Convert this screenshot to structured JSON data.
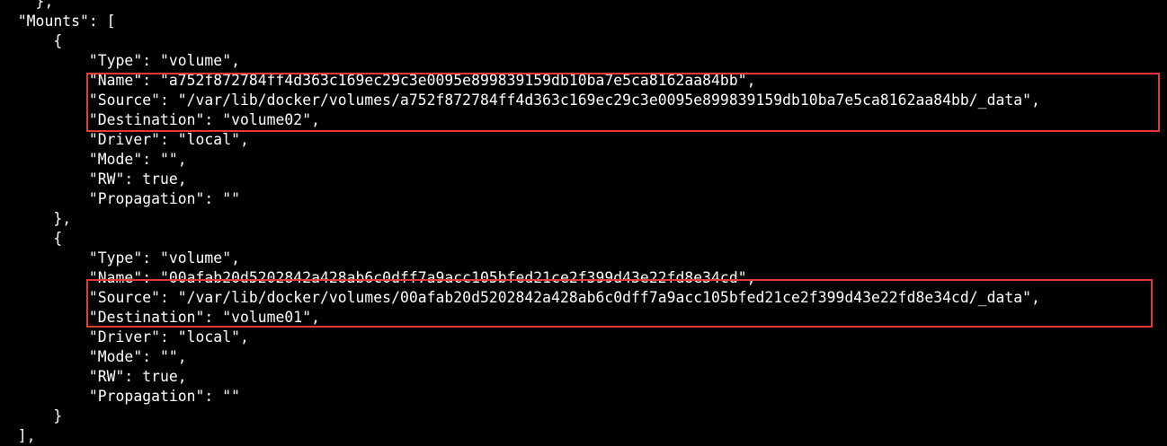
{
  "terminal": {
    "lines": [
      "    },",
      "  \"Mounts\": [",
      "      {",
      "          \"Type\": \"volume\",",
      "          \"Name\": \"a752f872784ff4d363c169ec29c3e0095e899839159db10ba7e5ca8162aa84bb\",",
      "          \"Source\": \"/var/lib/docker/volumes/a752f872784ff4d363c169ec29c3e0095e899839159db10ba7e5ca8162aa84bb/_data\",",
      "          \"Destination\": \"volume02\",",
      "          \"Driver\": \"local\",",
      "          \"Mode\": \"\",",
      "          \"RW\": true,",
      "          \"Propagation\": \"\"",
      "      },",
      "      {",
      "          \"Type\": \"volume\",",
      "          \"Name\": \"00afab20d5202842a428ab6c0dff7a9acc105bfed21ce2f399d43e22fd8e34cd\",",
      "          \"Source\": \"/var/lib/docker/volumes/00afab20d5202842a428ab6c0dff7a9acc105bfed21ce2f399d43e22fd8e34cd/_data\",",
      "          \"Destination\": \"volume01\",",
      "          \"Driver\": \"local\",",
      "          \"Mode\": \"\",",
      "          \"RW\": true,",
      "          \"Propagation\": \"\"",
      "      }",
      "  ],"
    ]
  },
  "colors": {
    "background": "#000000",
    "text": "#ffffff",
    "highlight_border": "#e53935"
  }
}
